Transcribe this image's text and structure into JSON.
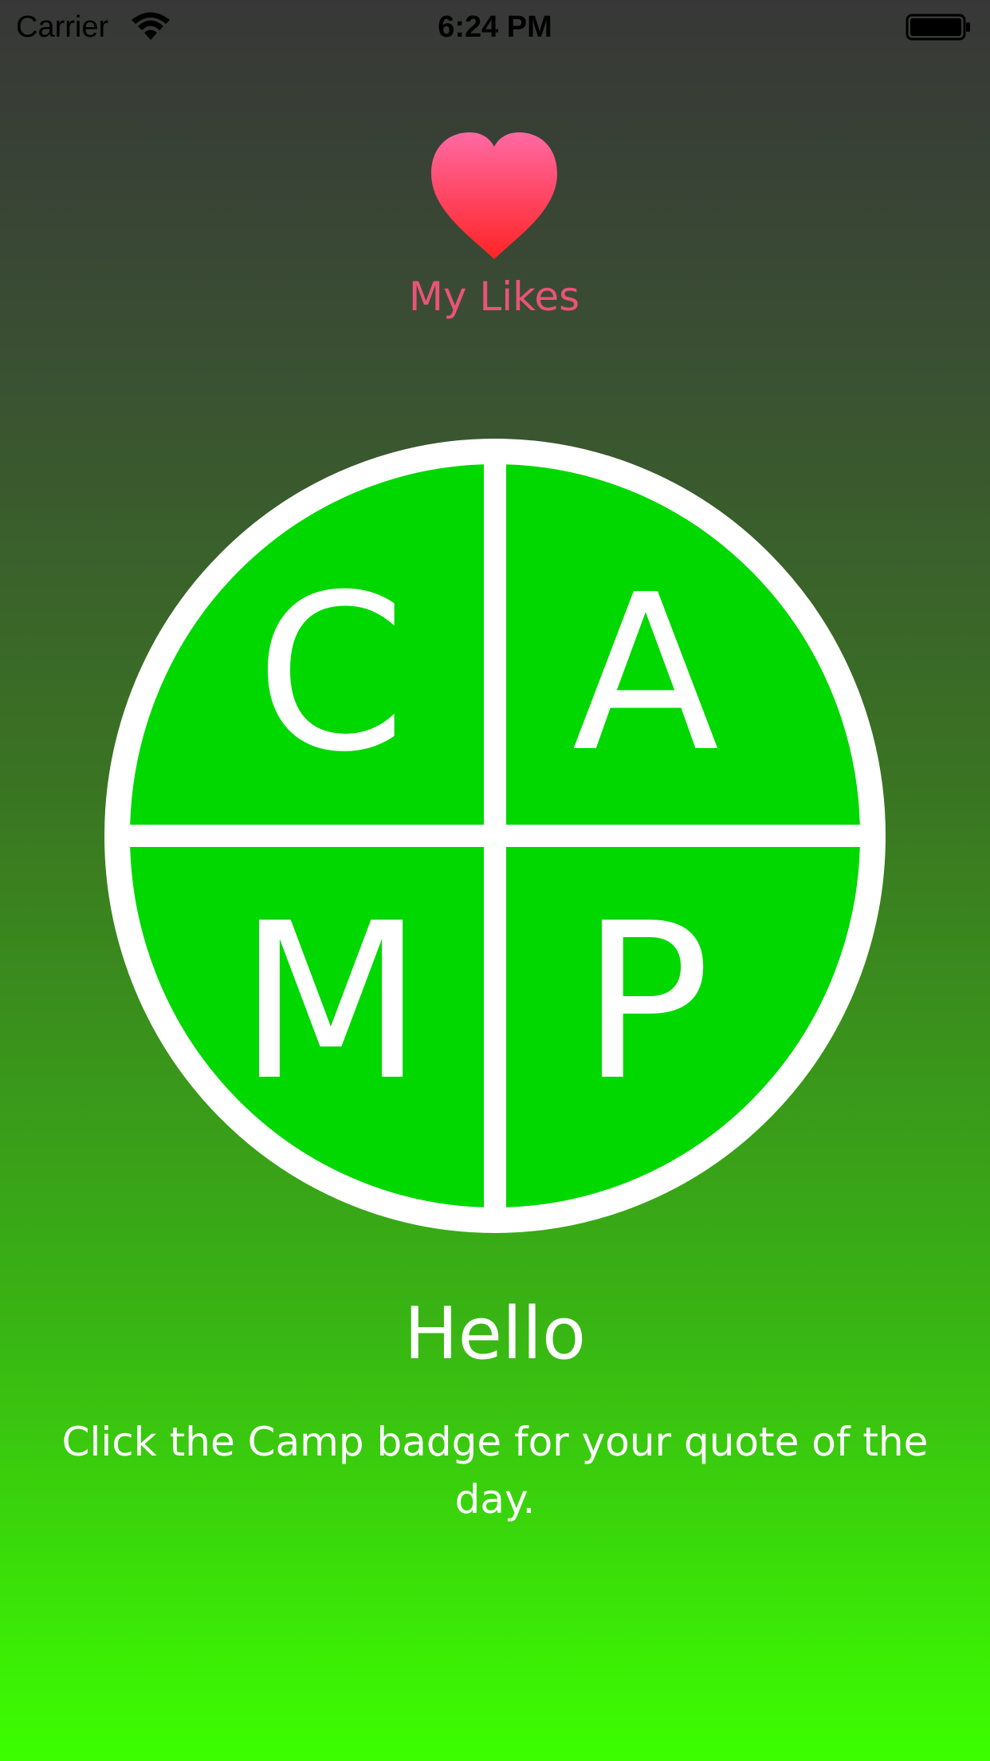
{
  "status_bar": {
    "carrier": "Carrier",
    "time": "6:24 PM",
    "wifi_icon": "wifi-icon",
    "battery_icon": "battery-icon"
  },
  "likes": {
    "icon": "heart-icon",
    "label": "My Likes",
    "label_color": "#e95479"
  },
  "badge": {
    "letters": [
      "C",
      "A",
      "M",
      "P"
    ],
    "fill_color": "#00d800",
    "stroke_color": "#ffffff"
  },
  "main": {
    "greeting": "Hello",
    "instructions": "Click the Camp badge for your quote of the day."
  },
  "colors": {
    "gradient_top": "#373737",
    "gradient_bottom": "#3cff00"
  }
}
